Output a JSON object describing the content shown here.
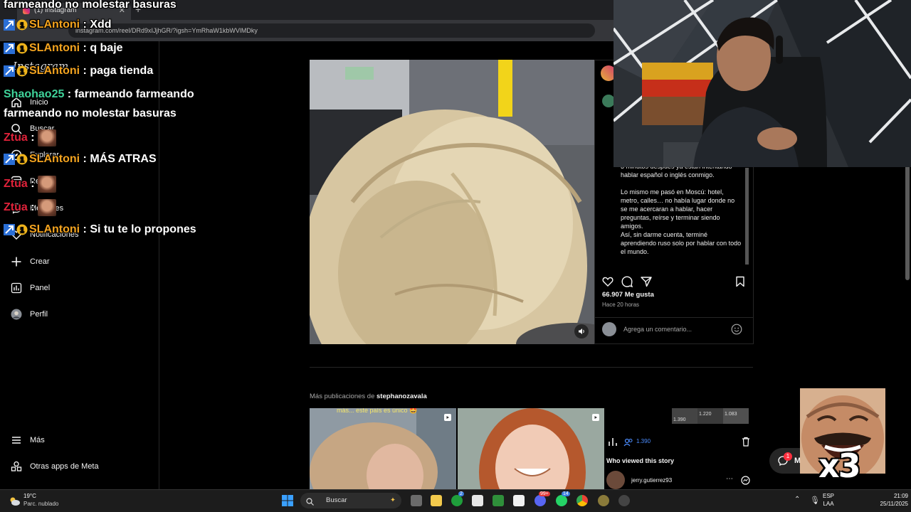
{
  "browser": {
    "tab_title": "(1) Instagram",
    "url": "instagram.com/reel/DRd9xIJjhGR/?igsh=YmRhaW1kbWVlMDky",
    "new_tab_icon": "+"
  },
  "sidebar": {
    "logo": "Instagram",
    "items": [
      {
        "label": "Inicio",
        "icon": "home-icon"
      },
      {
        "label": "Buscar",
        "icon": "search-icon"
      },
      {
        "label": "Explorar",
        "icon": "compass-icon"
      },
      {
        "label": "Reels",
        "icon": "reels-icon"
      },
      {
        "label": "Mensajes",
        "icon": "messenger-icon"
      },
      {
        "label": "Notificaciones",
        "icon": "heart-icon"
      },
      {
        "label": "Crear",
        "icon": "plus-icon"
      },
      {
        "label": "Panel",
        "icon": "chart-icon"
      },
      {
        "label": "Perfil",
        "icon": "avatar-icon"
      }
    ],
    "bottom": [
      {
        "label": "Más",
        "icon": "menu-icon"
      },
      {
        "label": "Otras apps de Meta",
        "icon": "meta-apps-icon"
      }
    ]
  },
  "post": {
    "caption": "3 minutos después ya están intentando hablar español o inglés conmigo.\n\nLo mismo me pasó en Moscú: hotel, metro, calles… no había lugar donde no se me acercaran a hablar, hacer preguntas, reírse y terminar siendo amigos.\nAsí, sin darme cuenta, terminé aprendiendo ruso solo por hablar con todo el mundo.",
    "likes": "66.907 Me gusta",
    "time": "Hace 20 horas",
    "comment_placeholder": "Agrega un comentario...",
    "more_prefix": "Más publicaciones de ",
    "more_user": "stephanozavala"
  },
  "thumbs": {
    "t1_caption": "más... este país es único 🤩",
    "views_count": "1.390",
    "who_viewed": "Who viewed this story",
    "viewer": "jerry.gutierrez93",
    "counts": [
      "1.220",
      "1.083",
      "1.390"
    ]
  },
  "chat": [
    {
      "user": "",
      "text": "farmeando no molestar basuras",
      "cls": "",
      "badges": false
    },
    {
      "user": "SLAntoni",
      "text": " : Xdd",
      "cls": "user-o",
      "badges": true
    },
    {
      "user": "SLAntoni",
      "text": " : q baje",
      "cls": "user-o",
      "badges": true
    },
    {
      "user": "SLAntoni",
      "text": " : paga tienda",
      "cls": "user-o",
      "badges": true
    },
    {
      "user": "Shaohao25",
      "text": " : farmeando farmeando",
      "cls": "user-g",
      "badges": false
    },
    {
      "user": "",
      "text": "farmeando no molestar basuras",
      "cls": "",
      "badges": false
    },
    {
      "user": "Ztua",
      "text": " :",
      "cls": "user-r",
      "badges": false,
      "emote": true
    },
    {
      "user": "SLAntoni",
      "text": " : MÁS ATRAS",
      "cls": "user-o",
      "badges": true
    },
    {
      "user": "Ztua",
      "text": " :",
      "cls": "user-r",
      "badges": false,
      "emote": true
    },
    {
      "user": "Ztua",
      "text": " :",
      "cls": "user-r",
      "badges": false,
      "emote": true
    },
    {
      "user": "SLAntoni",
      "text": " : Si tu te lo propones",
      "cls": "user-o",
      "badges": true
    }
  ],
  "overlay": {
    "multiplier": "x3",
    "notif_count": "1",
    "msg_letter": "M"
  },
  "taskbar": {
    "temperature": "19°C",
    "weather": "Parc. nublado",
    "search": "Buscar",
    "lang1": "ESP",
    "lang2": "LAA",
    "time": "21:09",
    "date": "25/11/2025",
    "badges": [
      "2",
      "99+",
      "14"
    ]
  },
  "colors": {
    "accent_blue": "#0095f6",
    "chat_orange": "#f3a31f",
    "chat_green": "#3fd39a",
    "chat_red": "#e0223a"
  }
}
